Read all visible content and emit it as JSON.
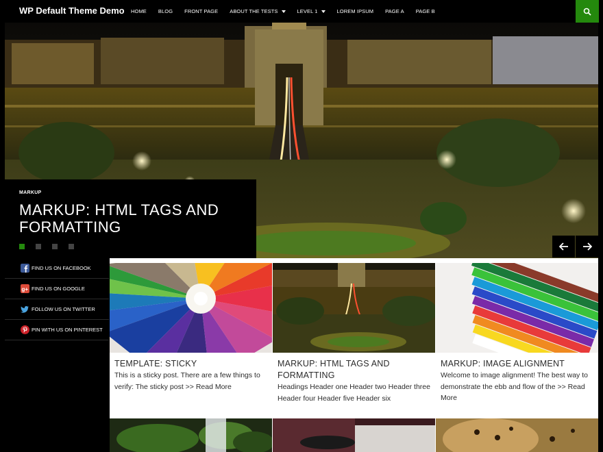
{
  "site": {
    "title": "WP Default Theme Demo"
  },
  "nav": {
    "items": [
      {
        "label": "HOME",
        "dropdown": false
      },
      {
        "label": "BLOG",
        "dropdown": false
      },
      {
        "label": "FRONT PAGE",
        "dropdown": false
      },
      {
        "label": "ABOUT THE TESTS",
        "dropdown": true
      },
      {
        "label": "LEVEL 1",
        "dropdown": true
      },
      {
        "label": "LOREM IPSUM",
        "dropdown": false
      },
      {
        "label": "PAGE A",
        "dropdown": false
      },
      {
        "label": "PAGE B",
        "dropdown": false
      }
    ],
    "search_icon": "search-icon"
  },
  "slider": {
    "category": "MARKUP",
    "title": "MARKUP: HTML TAGS AND FORMATTING",
    "slide_count": 4,
    "active_slide": 1
  },
  "sidebar": {
    "items": [
      {
        "label": "FIND US ON FACEBOOK",
        "icon": "facebook-icon"
      },
      {
        "label": "FIND US ON GOOGLE",
        "icon": "google-plus-icon"
      },
      {
        "label": "FOLLOW US ON TWITTER",
        "icon": "twitter-icon"
      },
      {
        "label": "PIN WITH US ON PINTEREST",
        "icon": "pinterest-icon"
      }
    ]
  },
  "posts": [
    {
      "title": "TEMPLATE: STICKY",
      "excerpt": "This is a sticky post. There are a few things to verify: The sticky post >> Read More",
      "image": "colored-pencils-circle"
    },
    {
      "title": "MARKUP: HTML TAGS AND FORMATTING",
      "excerpt": "Headings Header one Header two Header three Header four Header five Header six",
      "image": "night-bridge"
    },
    {
      "title": "MARKUP: IMAGE ALIGNMENT",
      "excerpt": "Welcome to image alignment! The best way to demonstrate the ebb and flow of the >> Read More",
      "image": "colored-pencils-row"
    }
  ],
  "colors": {
    "accent": "#24890d",
    "background": "#000000",
    "content_bg": "#ffffff",
    "text": "#2b2b2b"
  }
}
